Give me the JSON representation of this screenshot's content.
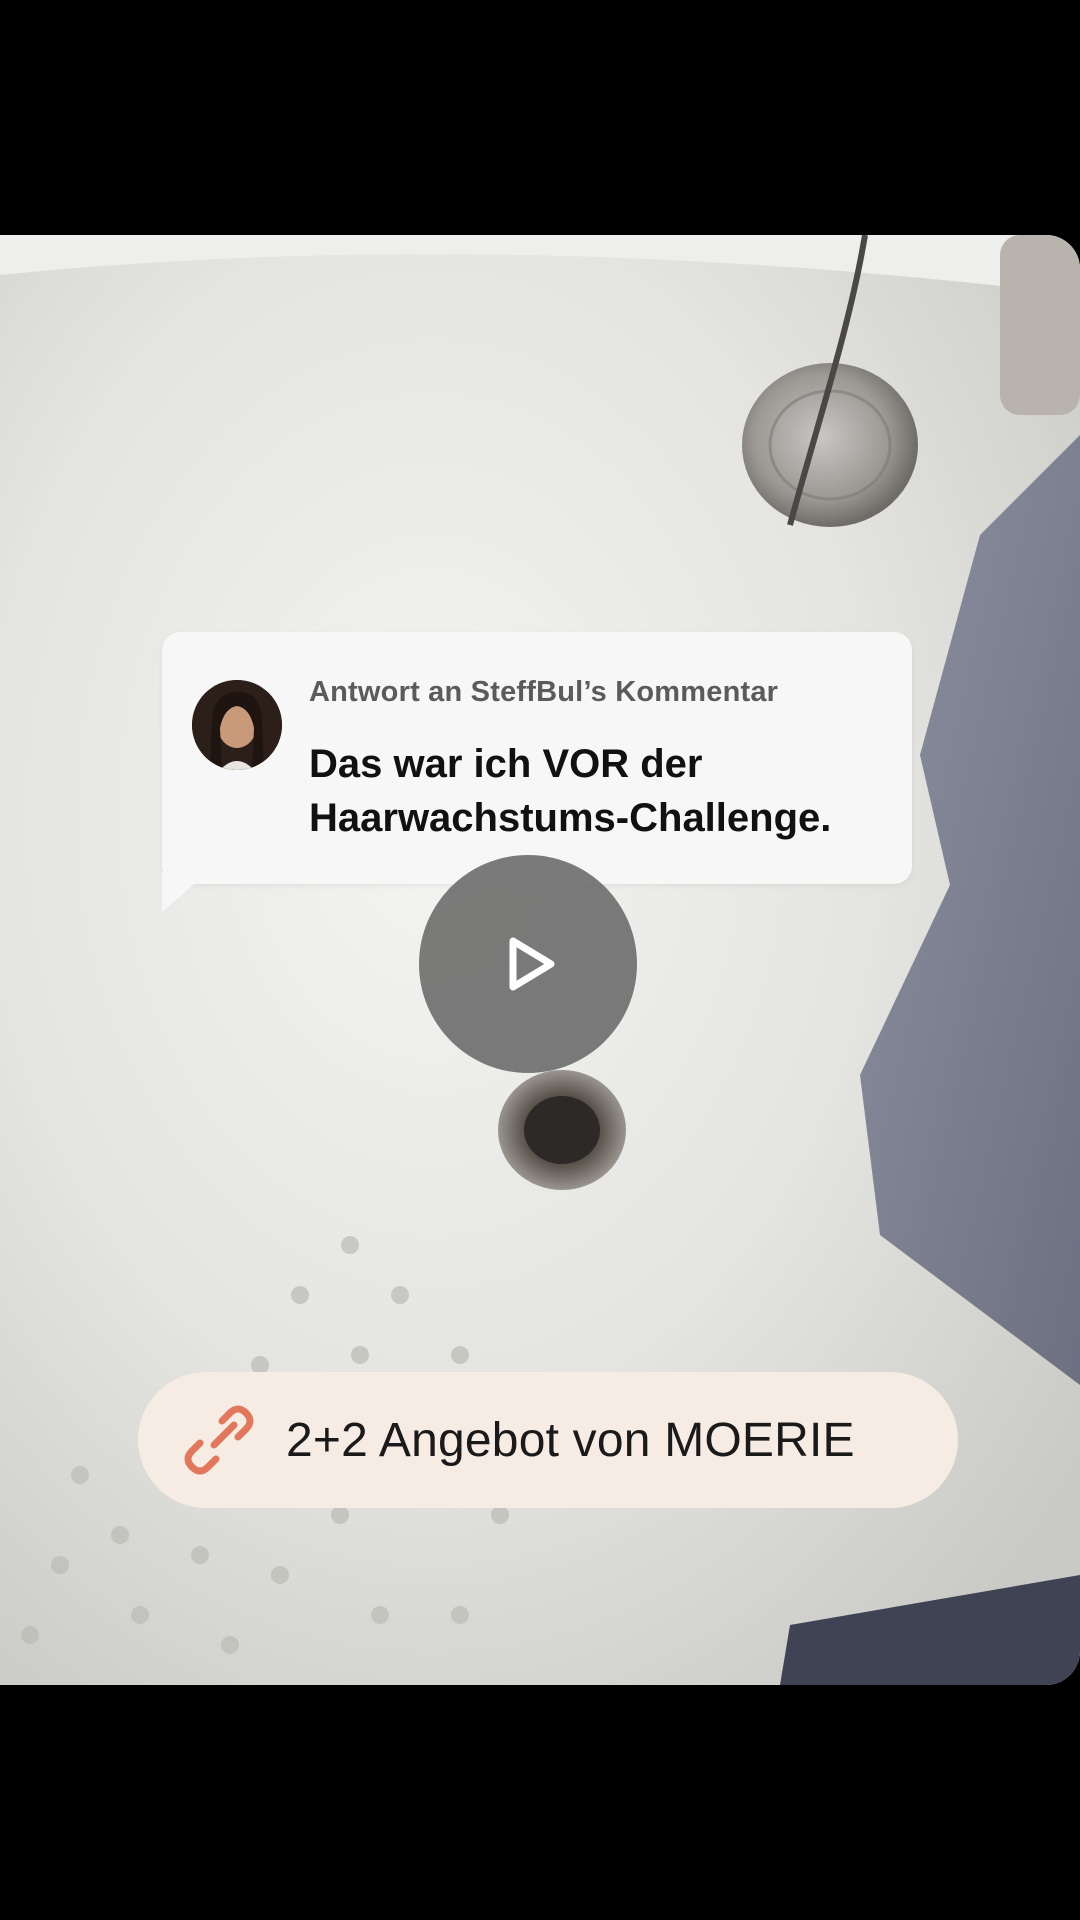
{
  "reply": {
    "meta": "Antwort an SteffBul’s Kommentar",
    "text": "Das war ich VOR der Haarwachstums-Challenge."
  },
  "player": {
    "play_icon": "play-icon"
  },
  "offer": {
    "icon": "link-icon",
    "label": "2+2 Angebot von MOERIE",
    "accent_color": "#e2775b"
  }
}
